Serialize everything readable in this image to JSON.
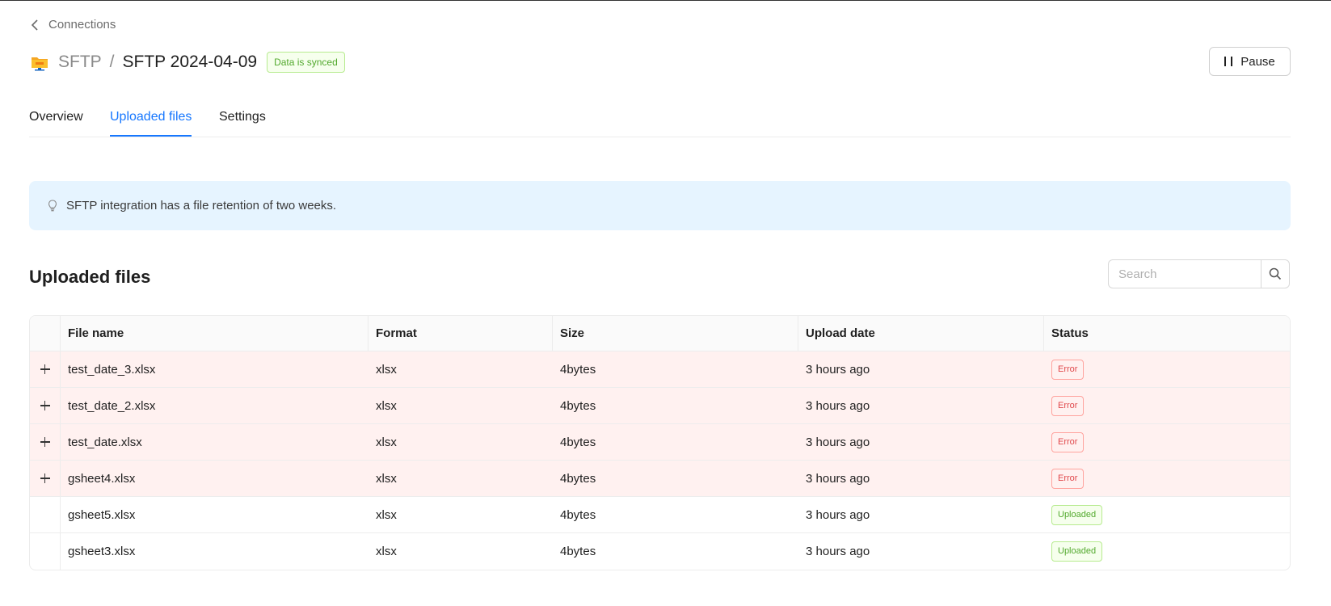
{
  "back": {
    "label": "Connections"
  },
  "header": {
    "crumb": "SFTP",
    "separator": "/",
    "title": "SFTP 2024-04-09",
    "badge": "Data is synced",
    "pause_label": "Pause"
  },
  "tabs": [
    {
      "label": "Overview",
      "active": false
    },
    {
      "label": "Uploaded files",
      "active": true
    },
    {
      "label": "Settings",
      "active": false
    }
  ],
  "notice": {
    "text": "SFTP integration has a file retention of two weeks."
  },
  "section": {
    "title": "Uploaded files"
  },
  "search": {
    "placeholder": "Search"
  },
  "table": {
    "columns": [
      "File name",
      "Format",
      "Size",
      "Upload date",
      "Status"
    ],
    "rows": [
      {
        "name": "test_date_3.xlsx",
        "format": "xlsx",
        "size": "4bytes",
        "date": "3 hours ago",
        "status": "Error",
        "expandable": true
      },
      {
        "name": "test_date_2.xlsx",
        "format": "xlsx",
        "size": "4bytes",
        "date": "3 hours ago",
        "status": "Error",
        "expandable": true
      },
      {
        "name": "test_date.xlsx",
        "format": "xlsx",
        "size": "4bytes",
        "date": "3 hours ago",
        "status": "Error",
        "expandable": true
      },
      {
        "name": "gsheet4.xlsx",
        "format": "xlsx",
        "size": "4bytes",
        "date": "3 hours ago",
        "status": "Error",
        "expandable": true
      },
      {
        "name": "gsheet5.xlsx",
        "format": "xlsx",
        "size": "4bytes",
        "date": "3 hours ago",
        "status": "Uploaded",
        "expandable": false
      },
      {
        "name": "gsheet3.xlsx",
        "format": "xlsx",
        "size": "4bytes",
        "date": "3 hours ago",
        "status": "Uploaded",
        "expandable": false
      }
    ]
  },
  "colors": {
    "accent": "#1677ff",
    "error": "#e0484b",
    "success": "#52a92d",
    "notice_bg": "#e6f4ff",
    "error_row_bg": "#fff1f0"
  }
}
